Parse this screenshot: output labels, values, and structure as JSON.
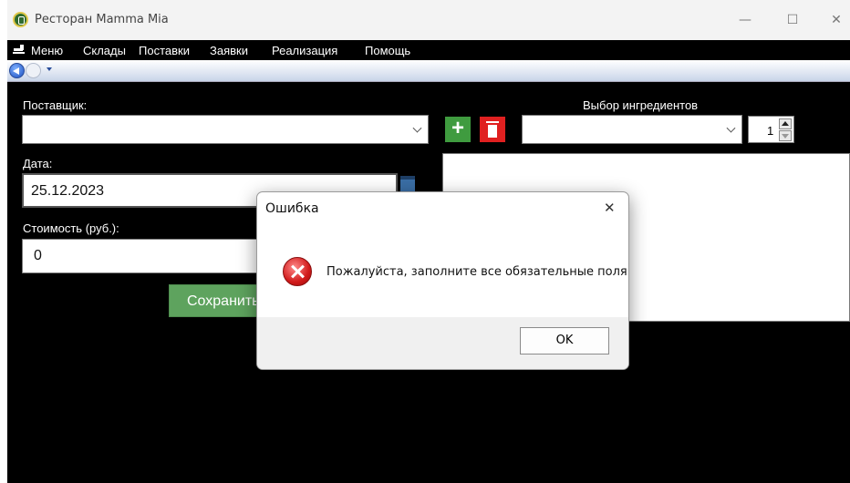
{
  "window": {
    "title": "Ресторан Mamma Mia",
    "controls": {
      "minimize": "—",
      "maximize": "☐",
      "close": "✕"
    }
  },
  "menubar": {
    "items": [
      "Меню",
      "Склады",
      "Поставки",
      "Заявки",
      "Реализация",
      "Помощь"
    ]
  },
  "navigation": {
    "back_icon": "back-arrow-icon",
    "forward_icon": "forward-arrow-icon"
  },
  "form": {
    "supplier_label": "Поставщик:",
    "supplier_value": "",
    "date_label": "Дата:",
    "date_value": "25.12.2023",
    "cost_label": "Стоимость (руб.):",
    "cost_value": "0",
    "save_label": "Сохранить",
    "ingredients_label": "Выбор ингредиентов",
    "ingredient_value": "",
    "quantity_value": "1"
  },
  "dialog": {
    "title": "Ошибка",
    "close": "✕",
    "message": "Пожалуйста, заполните все обязательные поля.",
    "ok_label": "OK"
  },
  "colors": {
    "background": "#000000",
    "add_button": "#3f9b3f",
    "delete_button": "#e02020",
    "save_button": "#5ea35e",
    "error_icon": "#d11a1a"
  }
}
